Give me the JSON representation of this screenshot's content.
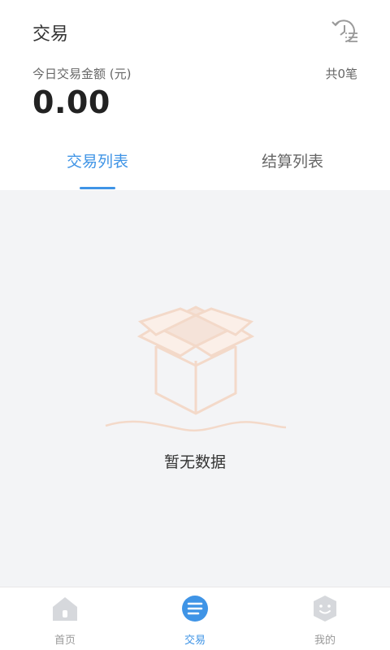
{
  "header": {
    "title": "交易",
    "history_icon": "history-list-icon"
  },
  "summary": {
    "label": "今日交易金额 (元)",
    "count": "共0笔",
    "amount": "0.00"
  },
  "tabs": [
    {
      "label": "交易列表",
      "active": true
    },
    {
      "label": "结算列表",
      "active": false
    }
  ],
  "empty_state": {
    "icon": "empty-box-icon",
    "message": "暂无数据"
  },
  "bottom_nav": [
    {
      "label": "首页",
      "icon": "home-icon",
      "active": false
    },
    {
      "label": "交易",
      "icon": "list-icon",
      "active": true
    },
    {
      "label": "我的",
      "icon": "profile-face-icon",
      "active": false
    }
  ],
  "colors": {
    "accent": "#3f94e6",
    "inactive_icon": "#d0d3d8",
    "background": "#f3f4f6",
    "illustration": "#f3d9c9"
  }
}
